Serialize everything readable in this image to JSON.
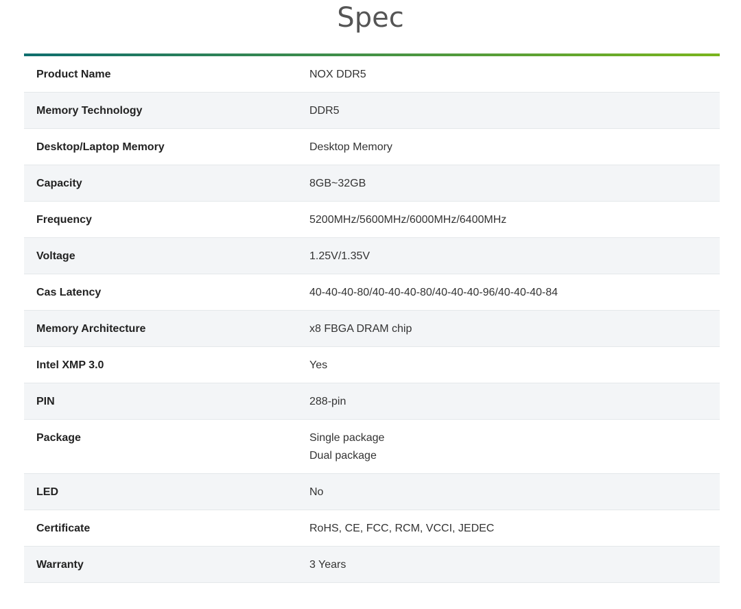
{
  "page": {
    "title": "Spec"
  },
  "colors": {
    "accent_start": "#0f6e6e",
    "accent_end": "#7ab51d",
    "row_alt": "#f3f5f7"
  },
  "specs": [
    {
      "label": "Product Name",
      "values": [
        "NOX DDR5"
      ]
    },
    {
      "label": "Memory Technology",
      "values": [
        "DDR5"
      ]
    },
    {
      "label": "Desktop/Laptop Memory",
      "values": [
        "Desktop Memory"
      ]
    },
    {
      "label": "Capacity",
      "values": [
        "8GB~32GB"
      ]
    },
    {
      "label": "Frequency",
      "values": [
        "5200MHz/5600MHz/6000MHz/6400MHz"
      ]
    },
    {
      "label": "Voltage",
      "values": [
        "1.25V/1.35V"
      ]
    },
    {
      "label": "Cas Latency",
      "values": [
        "40-40-40-80/40-40-40-80/40-40-40-96/40-40-40-84"
      ]
    },
    {
      "label": "Memory Architecture",
      "values": [
        "x8 FBGA DRAM chip"
      ]
    },
    {
      "label": "Intel XMP 3.0",
      "values": [
        "Yes"
      ]
    },
    {
      "label": "PIN",
      "values": [
        "288-pin"
      ]
    },
    {
      "label": "Package",
      "values": [
        "Single package",
        "Dual package"
      ]
    },
    {
      "label": "LED",
      "values": [
        "No"
      ]
    },
    {
      "label": "Certificate",
      "values": [
        "RoHS, CE, FCC, RCM, VCCI, JEDEC"
      ]
    },
    {
      "label": "Warranty",
      "values": [
        "3 Years"
      ]
    }
  ]
}
